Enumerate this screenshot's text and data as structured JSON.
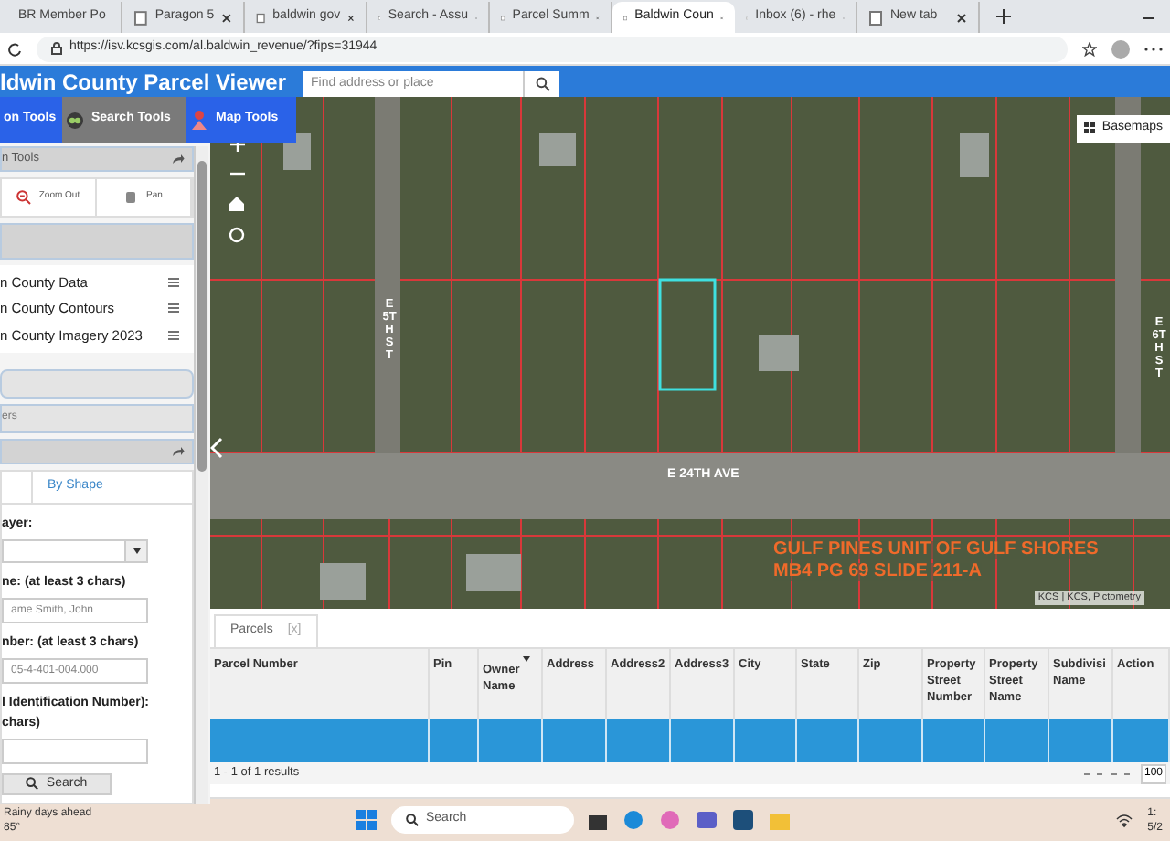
{
  "browser": {
    "tabs": [
      {
        "title": "BR Member Po",
        "selected": false
      },
      {
        "title": "Paragon 5",
        "selected": false
      },
      {
        "title": "baldwin gov",
        "selected": false
      },
      {
        "title": "Search - Assu",
        "selected": false
      },
      {
        "title": "Parcel Summ",
        "selected": false
      },
      {
        "title": "Baldwin Coun",
        "selected": true
      },
      {
        "title": "Inbox (6) - rhe",
        "selected": false
      },
      {
        "title": "New tab",
        "selected": false
      }
    ],
    "url": "https://isv.kcsgis.com/al.baldwin_revenue/?fips=31944"
  },
  "app": {
    "title": "ldwin County Parcel Viewer",
    "search": {
      "placeholder": "Find address or place"
    },
    "toolbar": [
      {
        "label": "on Tools",
        "selected": false
      },
      {
        "label": "Search Tools",
        "selected": true
      },
      {
        "label": "Map Tools",
        "selected": false
      }
    ]
  },
  "left_panel": {
    "tools_header": "n Tools",
    "tools": [
      {
        "label": "Zoom Out"
      },
      {
        "label": "Pan"
      }
    ],
    "layers": [
      "n County Data",
      "n County Contours",
      "n County Imagery 2023"
    ],
    "collapsed_section": "ers",
    "search_tabs": [
      {
        "selected": true
      },
      {
        "label": "By Shape",
        "selected": false
      }
    ],
    "form": [
      {
        "kind": "select",
        "label": "ayer:"
      },
      {
        "kind": "input",
        "label": "ne: (at least 3 chars)",
        "placeholder": "ame Smith, John"
      },
      {
        "kind": "input",
        "label": "nber: (at least 3 chars)",
        "placeholder": "05-4-401-004.000"
      },
      {
        "kind": "input",
        "label": "l Identification Number): chars)"
      }
    ],
    "search_button": "Search"
  },
  "map": {
    "basemaps": "Basemaps",
    "labels": [
      {
        "kind": "street-v",
        "text": "E 5TH ST"
      },
      {
        "kind": "street-v2",
        "text": "E 6TH ST"
      },
      {
        "kind": "street-h",
        "text": "E 24TH AVE"
      },
      {
        "kind": "subdivision",
        "text": "GULF PINES UNIT OF GULF SHORES"
      },
      {
        "kind": "subdivision2",
        "text": "MB4 PG 69 SLIDE 211-A"
      }
    ],
    "attribution": "KCS | KCS, Pictometry"
  },
  "results": {
    "tab": "Parcels",
    "tab_close": "[x]",
    "columns": [
      "Parcel Number",
      "Pin",
      "Owner Name",
      "Address",
      "Address2",
      "Address3",
      "City",
      "State",
      "Zip",
      "Property Street Number",
      "Property Street Name",
      "Subdivisi Name",
      "Action"
    ],
    "row_selected": true,
    "footer": "1 - 1 of 1 results",
    "page_size": "100"
  },
  "taskbar": {
    "weather": [
      "Rainy days ahead",
      "85°"
    ],
    "search": "Search",
    "time": "1:",
    "date": "5/2"
  }
}
